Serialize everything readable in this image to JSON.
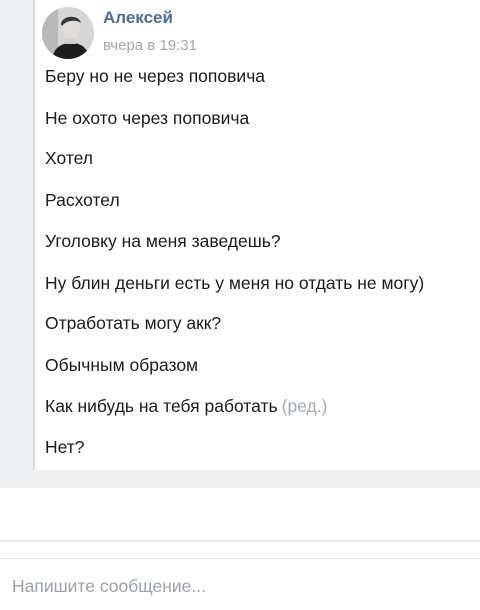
{
  "message": {
    "author": "Алексей",
    "time": "вчера в 19:31",
    "lines": [
      "Беру но не через поповича",
      "Не охото через поповича",
      "Хотел",
      "Расхотел",
      "Уголовку на меня заведешь?",
      "Ну блин деньги есть у меня но отдать не могу)",
      "Отработать могу акк?",
      "Обычным образом",
      "Как нибудь на тебя работать",
      "Нет?"
    ],
    "edited_label": "(ред.)"
  },
  "composer": {
    "placeholder": "Напишите сообщение..."
  }
}
